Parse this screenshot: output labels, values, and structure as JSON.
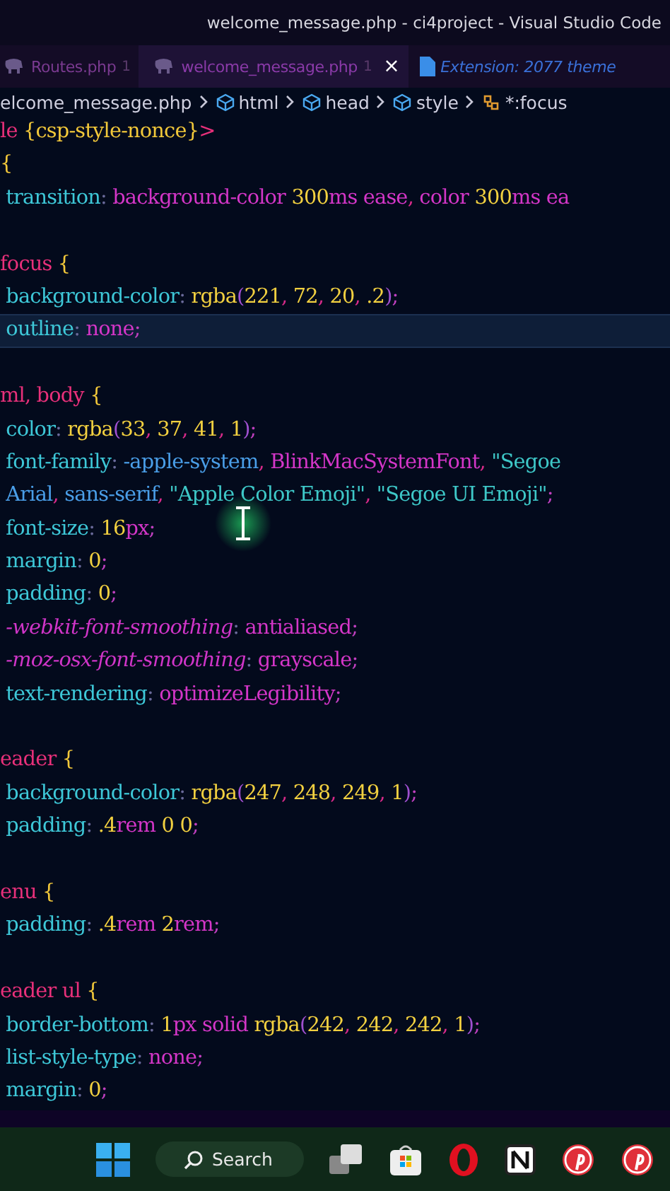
{
  "window": {
    "title": "welcome_message.php - ci4project - Visual Studio Code"
  },
  "tabs": [
    {
      "label": "Routes.php",
      "badge": "1",
      "selected": false
    },
    {
      "label": "welcome_message.php",
      "badge": "1",
      "selected": true,
      "close": "×"
    },
    {
      "label": "Extension: 2077 theme",
      "selected": false
    }
  ],
  "breadcrumb": [
    {
      "label": "elcome_message.php"
    },
    {
      "label": "html"
    },
    {
      "label": "head"
    },
    {
      "label": "style"
    },
    {
      "label": "*:focus"
    }
  ],
  "code": {
    "lines": [
      {
        "current": false,
        "tokens": [
          {
            "kind": "tag",
            "text": "le "
          },
          {
            "kind": "brace",
            "text": "{csp-style-nonce}"
          },
          {
            "kind": "tag",
            "text": ">"
          }
        ]
      },
      {
        "current": false,
        "tokens": [
          {
            "kind": "brace",
            "text": "{"
          }
        ]
      },
      {
        "current": false,
        "tokens": [
          {
            "kind": "prop",
            "text": " transition"
          },
          {
            "kind": "colon",
            "text": ": "
          },
          {
            "kind": "val",
            "text": "background-color "
          },
          {
            "kind": "num",
            "text": "300"
          },
          {
            "kind": "val",
            "text": "ms ease"
          },
          {
            "kind": "comma",
            "text": ", "
          },
          {
            "kind": "val",
            "text": "color "
          },
          {
            "kind": "num",
            "text": "300"
          },
          {
            "kind": "val",
            "text": "ms ea"
          }
        ]
      },
      {
        "current": false
      },
      {
        "current": false,
        "tokens": [
          {
            "kind": "sel",
            "text": "focus "
          },
          {
            "kind": "brace",
            "text": "{"
          }
        ]
      },
      {
        "current": false,
        "tokens": [
          {
            "kind": "prop",
            "text": " background-color"
          },
          {
            "kind": "colon",
            "text": ": "
          },
          {
            "kind": "fn",
            "text": "rgba"
          },
          {
            "kind": "paren",
            "text": "("
          },
          {
            "kind": "num",
            "text": "221"
          },
          {
            "kind": "comma",
            "text": ", "
          },
          {
            "kind": "num",
            "text": "72"
          },
          {
            "kind": "comma",
            "text": ", "
          },
          {
            "kind": "num",
            "text": "20"
          },
          {
            "kind": "comma",
            "text": ", "
          },
          {
            "kind": "num",
            "text": ".2"
          },
          {
            "kind": "paren",
            "text": ")"
          },
          {
            "kind": "semi",
            "text": ";"
          }
        ]
      },
      {
        "current": true,
        "tokens": [
          {
            "kind": "prop",
            "text": " outline"
          },
          {
            "kind": "colon",
            "text": ": "
          },
          {
            "kind": "val",
            "text": "none"
          },
          {
            "kind": "semi",
            "text": ";"
          }
        ]
      },
      {
        "current": false
      },
      {
        "current": false,
        "tokens": [
          {
            "kind": "sel",
            "text": "ml, body "
          },
          {
            "kind": "brace",
            "text": "{"
          }
        ]
      },
      {
        "current": false,
        "tokens": [
          {
            "kind": "prop",
            "text": " color"
          },
          {
            "kind": "colon",
            "text": ": "
          },
          {
            "kind": "fn",
            "text": "rgba"
          },
          {
            "kind": "paren",
            "text": "("
          },
          {
            "kind": "num",
            "text": "33"
          },
          {
            "kind": "comma",
            "text": ", "
          },
          {
            "kind": "num",
            "text": "37"
          },
          {
            "kind": "comma",
            "text": ", "
          },
          {
            "kind": "num",
            "text": "41"
          },
          {
            "kind": "comma",
            "text": ", "
          },
          {
            "kind": "num",
            "text": "1"
          },
          {
            "kind": "paren",
            "text": ")"
          },
          {
            "kind": "semi",
            "text": ";"
          }
        ]
      },
      {
        "current": false,
        "tokens": [
          {
            "kind": "prop",
            "text": " font-family"
          },
          {
            "kind": "colon",
            "text": ": "
          },
          {
            "kind": "str2",
            "text": "-apple-system"
          },
          {
            "kind": "comma",
            "text": ", "
          },
          {
            "kind": "val",
            "text": "BlinkMacSystemFont"
          },
          {
            "kind": "comma",
            "text": ", "
          },
          {
            "kind": "str",
            "text": "\"Segoe"
          }
        ]
      },
      {
        "current": false,
        "tokens": [
          {
            "kind": "str2",
            "text": " Arial"
          },
          {
            "kind": "comma",
            "text": ", "
          },
          {
            "kind": "str2",
            "text": "sans-serif"
          },
          {
            "kind": "comma",
            "text": ", "
          },
          {
            "kind": "str",
            "text": "\"Apple Color Emoji\""
          },
          {
            "kind": "comma",
            "text": ", "
          },
          {
            "kind": "str",
            "text": "\"Segoe UI Emoji\""
          },
          {
            "kind": "semi",
            "text": ";"
          }
        ]
      },
      {
        "current": false,
        "tokens": [
          {
            "kind": "prop",
            "text": " font-size"
          },
          {
            "kind": "colon",
            "text": ": "
          },
          {
            "kind": "num",
            "text": "16"
          },
          {
            "kind": "val",
            "text": "px"
          },
          {
            "kind": "semi",
            "text": ";"
          }
        ]
      },
      {
        "current": false,
        "tokens": [
          {
            "kind": "prop",
            "text": " margin"
          },
          {
            "kind": "colon",
            "text": ": "
          },
          {
            "kind": "num",
            "text": "0"
          },
          {
            "kind": "semi",
            "text": ";"
          }
        ]
      },
      {
        "current": false,
        "tokens": [
          {
            "kind": "prop",
            "text": " padding"
          },
          {
            "kind": "colon",
            "text": ": "
          },
          {
            "kind": "num",
            "text": "0"
          },
          {
            "kind": "semi",
            "text": ";"
          }
        ]
      },
      {
        "current": false,
        "tokens": [
          {
            "kind": "vprop",
            "text": " -webkit-font-smoothing"
          },
          {
            "kind": "colon",
            "text": ": "
          },
          {
            "kind": "val",
            "text": "antialiased"
          },
          {
            "kind": "semi",
            "text": ";"
          }
        ]
      },
      {
        "current": false,
        "tokens": [
          {
            "kind": "vprop",
            "text": " -moz-osx-font-smoothing"
          },
          {
            "kind": "colon",
            "text": ": "
          },
          {
            "kind": "val",
            "text": "grayscale"
          },
          {
            "kind": "semi",
            "text": ";"
          }
        ]
      },
      {
        "current": false,
        "tokens": [
          {
            "kind": "prop",
            "text": " text-rendering"
          },
          {
            "kind": "colon",
            "text": ": "
          },
          {
            "kind": "val",
            "text": "optimizeLegibility"
          },
          {
            "kind": "semi",
            "text": ";"
          }
        ]
      },
      {
        "current": false
      },
      {
        "current": false,
        "tokens": [
          {
            "kind": "sel",
            "text": "eader "
          },
          {
            "kind": "brace",
            "text": "{"
          }
        ]
      },
      {
        "current": false,
        "tokens": [
          {
            "kind": "prop",
            "text": " background-color"
          },
          {
            "kind": "colon",
            "text": ": "
          },
          {
            "kind": "fn",
            "text": "rgba"
          },
          {
            "kind": "paren",
            "text": "("
          },
          {
            "kind": "num",
            "text": "247"
          },
          {
            "kind": "comma",
            "text": ", "
          },
          {
            "kind": "num",
            "text": "248"
          },
          {
            "kind": "comma",
            "text": ", "
          },
          {
            "kind": "num",
            "text": "249"
          },
          {
            "kind": "comma",
            "text": ", "
          },
          {
            "kind": "num",
            "text": "1"
          },
          {
            "kind": "paren",
            "text": ")"
          },
          {
            "kind": "semi",
            "text": ";"
          }
        ]
      },
      {
        "current": false,
        "tokens": [
          {
            "kind": "prop",
            "text": " padding"
          },
          {
            "kind": "colon",
            "text": ": "
          },
          {
            "kind": "num",
            "text": ".4"
          },
          {
            "kind": "val",
            "text": "rem "
          },
          {
            "kind": "num",
            "text": "0 0"
          },
          {
            "kind": "semi",
            "text": ";"
          }
        ]
      },
      {
        "current": false
      },
      {
        "current": false,
        "tokens": [
          {
            "kind": "sel",
            "text": "enu "
          },
          {
            "kind": "brace",
            "text": "{"
          }
        ]
      },
      {
        "current": false,
        "tokens": [
          {
            "kind": "prop",
            "text": " padding"
          },
          {
            "kind": "colon",
            "text": ": "
          },
          {
            "kind": "num",
            "text": ".4"
          },
          {
            "kind": "val",
            "text": "rem "
          },
          {
            "kind": "num",
            "text": "2"
          },
          {
            "kind": "val",
            "text": "rem"
          },
          {
            "kind": "semi",
            "text": ";"
          }
        ]
      },
      {
        "current": false
      },
      {
        "current": false,
        "tokens": [
          {
            "kind": "sel",
            "text": "eader ul "
          },
          {
            "kind": "brace",
            "text": "{"
          }
        ]
      },
      {
        "current": false,
        "tokens": [
          {
            "kind": "prop",
            "text": " border-bottom"
          },
          {
            "kind": "colon",
            "text": ": "
          },
          {
            "kind": "num",
            "text": "1"
          },
          {
            "kind": "val",
            "text": "px solid "
          },
          {
            "kind": "fn",
            "text": "rgba"
          },
          {
            "kind": "paren",
            "text": "("
          },
          {
            "kind": "num",
            "text": "242"
          },
          {
            "kind": "comma",
            "text": ", "
          },
          {
            "kind": "num",
            "text": "242"
          },
          {
            "kind": "comma",
            "text": ", "
          },
          {
            "kind": "num",
            "text": "242"
          },
          {
            "kind": "comma",
            "text": ", "
          },
          {
            "kind": "num",
            "text": "1"
          },
          {
            "kind": "paren",
            "text": ")"
          },
          {
            "kind": "semi",
            "text": ";"
          }
        ]
      },
      {
        "current": false,
        "tokens": [
          {
            "kind": "prop",
            "text": " list-style-type"
          },
          {
            "kind": "colon",
            "text": ": "
          },
          {
            "kind": "val",
            "text": "none"
          },
          {
            "kind": "semi",
            "text": ";"
          }
        ]
      },
      {
        "current": false,
        "tokens": [
          {
            "kind": "prop",
            "text": " margin"
          },
          {
            "kind": "colon",
            "text": ": "
          },
          {
            "kind": "num",
            "text": "0"
          },
          {
            "kind": "semi",
            "text": ";"
          }
        ]
      }
    ]
  },
  "taskbar": {
    "items": [
      {
        "kind": "start"
      },
      {
        "kind": "search",
        "label": "Search"
      },
      {
        "kind": "taskview"
      },
      {
        "kind": "store"
      },
      {
        "kind": "opera"
      },
      {
        "kind": "notion"
      },
      {
        "kind": "pinterest"
      },
      {
        "kind": "pinterest"
      }
    ]
  }
}
